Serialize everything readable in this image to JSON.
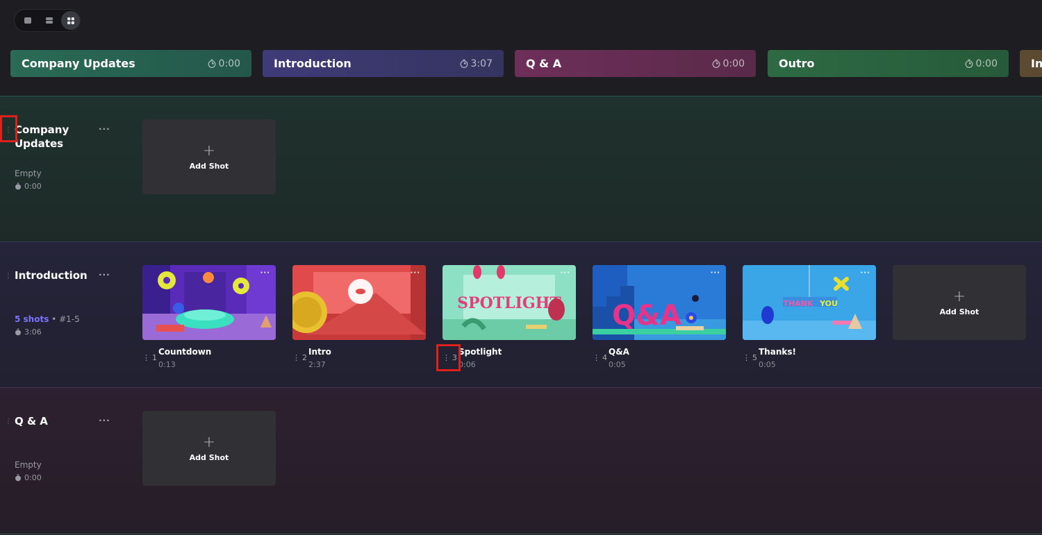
{
  "view_toggle": {
    "options": [
      "list-view-icon",
      "compact-view-icon",
      "grid-view-icon"
    ],
    "active": "grid-view-icon"
  },
  "chips": [
    {
      "title": "Company Updates",
      "duration": "0:00",
      "color": "#2a6b55"
    },
    {
      "title": "Introduction",
      "duration": "3:07",
      "color": "#3f3b78"
    },
    {
      "title": "Q & A",
      "duration": "0:00",
      "color": "#6e2f5a"
    },
    {
      "title": "Outro",
      "duration": "0:00",
      "color": "#2d6a43"
    },
    {
      "title": "In",
      "duration": "",
      "color": "#5d4a32"
    }
  ],
  "sections": {
    "company_updates": {
      "title": "Company Updates",
      "status": "Empty",
      "duration": "0:00",
      "add_shot_label": "Add Shot",
      "bg": "#1d2c29"
    },
    "introduction": {
      "title": "Introduction",
      "shots_count": "5 shots",
      "separator": "•",
      "range": "#1-5",
      "duration": "3:06",
      "add_shot_label": "Add Shot",
      "bg": "#232333",
      "shots": [
        {
          "num": "1",
          "title": "Countdown",
          "duration": "0:13",
          "image": "colorful 3D room with rings and donuts"
        },
        {
          "num": "2",
          "title": "Intro",
          "duration": "2:37",
          "image": "red room with yellow disc"
        },
        {
          "num": "3",
          "title": "Spotlight",
          "duration": "0:06",
          "image": "mint room with SPOTLIGHT text"
        },
        {
          "num": "4",
          "title": "Q&A",
          "duration": "0:05",
          "image": "blue room with pink Q&A letters"
        },
        {
          "num": "5",
          "title": "Thanks!",
          "duration": "0:05",
          "image": "blue scene with THANK YOU text"
        }
      ]
    },
    "qa": {
      "title": "Q & A",
      "status": "Empty",
      "duration": "0:00",
      "add_shot_label": "Add Shot",
      "bg": "#2b1f2b"
    }
  },
  "menu_glyph": "···",
  "thumb_text": {
    "spotlight": "SPOTLIGHT",
    "qa": "Q&A",
    "thank": "THANK",
    "you": "YOU"
  }
}
